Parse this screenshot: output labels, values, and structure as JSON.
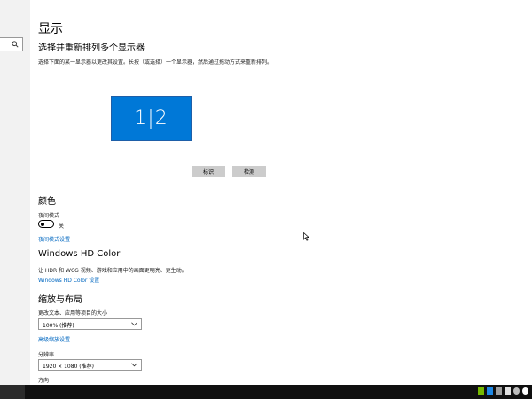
{
  "page_title": "显示",
  "arrange": {
    "heading": "选择并重新排列多个显示器",
    "description": "选择下面的某一显示器以更改其设置。长按（或选择）一个显示器，然后通过拖动方式来重新排列。",
    "monitor_label": "1|2",
    "identify_label": "标识",
    "detect_label": "检测"
  },
  "color": {
    "heading": "颜色",
    "night_light_label": "夜间模式",
    "toggle_state": "关",
    "night_light_link": "夜间模式设置"
  },
  "hd_color": {
    "heading": "Windows HD Color",
    "description": "让 HDR 和 WCG 视频、游戏和应用中的画面更明亮、更生动。",
    "link": "Windows HD Color 设置"
  },
  "scale": {
    "heading": "缩放与布局",
    "scale_label": "更改文本、应用等项目的大小",
    "scale_value": "100% (推荐)",
    "advanced_link": "高级缩放设置",
    "resolution_label": "分辨率",
    "resolution_value": "1920 × 1080 (推荐)",
    "orientation_label": "方向"
  },
  "colors": {
    "accent": "#0078d7",
    "link": "#0067c0",
    "taskbar": "#101010"
  },
  "taskbar": {
    "tray_icons": [
      "nvidia-icon",
      "bluetooth-icon",
      "network-icon",
      "volume-icon",
      "clock-icon",
      "power-icon"
    ]
  }
}
